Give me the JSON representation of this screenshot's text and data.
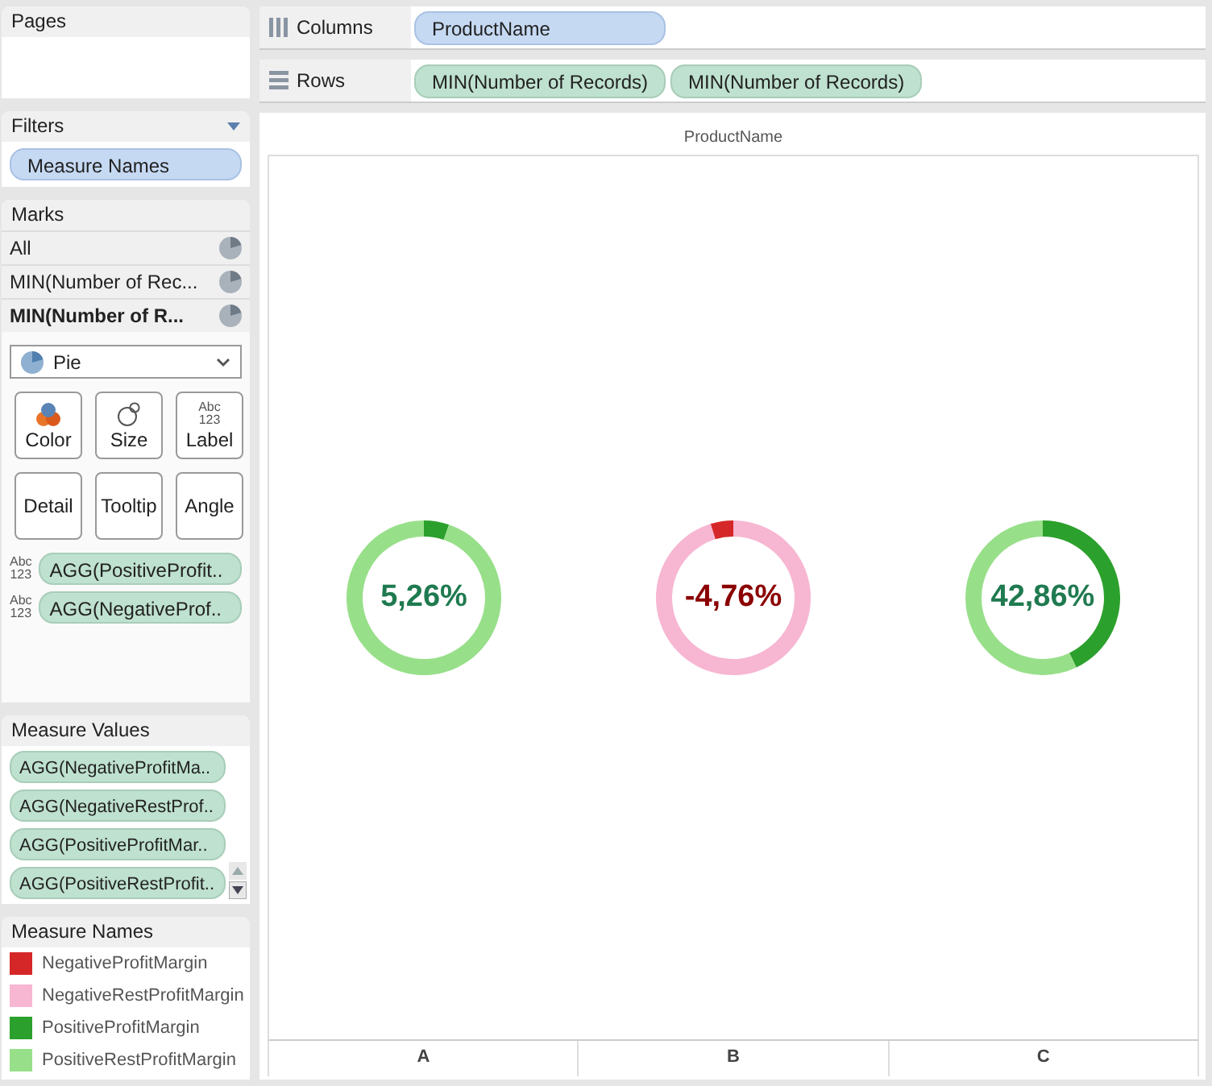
{
  "pages": {
    "title": "Pages"
  },
  "filters": {
    "title": "Filters",
    "pills": [
      "Measure Names"
    ]
  },
  "marks": {
    "title": "Marks",
    "layers": [
      {
        "label": "All",
        "selected": false
      },
      {
        "label": "MIN(Number of Rec...",
        "selected": false
      },
      {
        "label": "MIN(Number of R...",
        "selected": true
      }
    ],
    "mark_type": "Pie",
    "buttons": [
      {
        "label": "Color",
        "kind": "color"
      },
      {
        "label": "Size",
        "kind": "size"
      },
      {
        "label": "Label",
        "kind": "label",
        "icon_lines": [
          "Abc",
          "123"
        ]
      },
      {
        "label": "Detail",
        "kind": "plain"
      },
      {
        "label": "Tooltip",
        "kind": "plain"
      },
      {
        "label": "Angle",
        "kind": "plain"
      }
    ],
    "pills": [
      {
        "icon_lines": [
          "Abc",
          "123"
        ],
        "text": "AGG(PositiveProfit.."
      },
      {
        "icon_lines": [
          "Abc",
          "123"
        ],
        "text": "AGG(NegativeProf.."
      }
    ]
  },
  "measure_values": {
    "title": "Measure Values",
    "pills": [
      "AGG(NegativeProfitMa..",
      "AGG(NegativeRestProf..",
      "AGG(PositiveProfitMar..",
      "AGG(PositiveRestProfit.."
    ]
  },
  "measure_names": {
    "title": "Measure Names",
    "items": [
      {
        "label": "NegativeProfitMargin",
        "color": "#d62728"
      },
      {
        "label": "NegativeRestProfitMargin",
        "color": "#f7b6d2"
      },
      {
        "label": "PositiveProfitMargin",
        "color": "#2ca02c"
      },
      {
        "label": "PositiveRestProfitMargin",
        "color": "#98df8a"
      }
    ]
  },
  "columns_shelf": {
    "label": "Columns",
    "pills": [
      {
        "text": "ProductName",
        "kind": "dimension"
      }
    ]
  },
  "rows_shelf": {
    "label": "Rows",
    "pills": [
      {
        "text": "MIN(Number of Records)",
        "kind": "measure"
      },
      {
        "text": "MIN(Number of Records)",
        "kind": "measure"
      }
    ]
  },
  "view": {
    "header": "ProductName",
    "cells": [
      {
        "column": "A",
        "label": "5,26%",
        "kind": "positive",
        "chart_data": {
          "type": "donut",
          "values": [
            5.26,
            94.74
          ]
        }
      },
      {
        "column": "B",
        "label": "-4,76%",
        "kind": "negative",
        "chart_data": {
          "type": "donut",
          "values": [
            4.76,
            95.24
          ]
        }
      },
      {
        "column": "C",
        "label": "42,86%",
        "kind": "positive",
        "chart_data": {
          "type": "donut",
          "values": [
            42.86,
            57.14
          ]
        }
      }
    ]
  }
}
